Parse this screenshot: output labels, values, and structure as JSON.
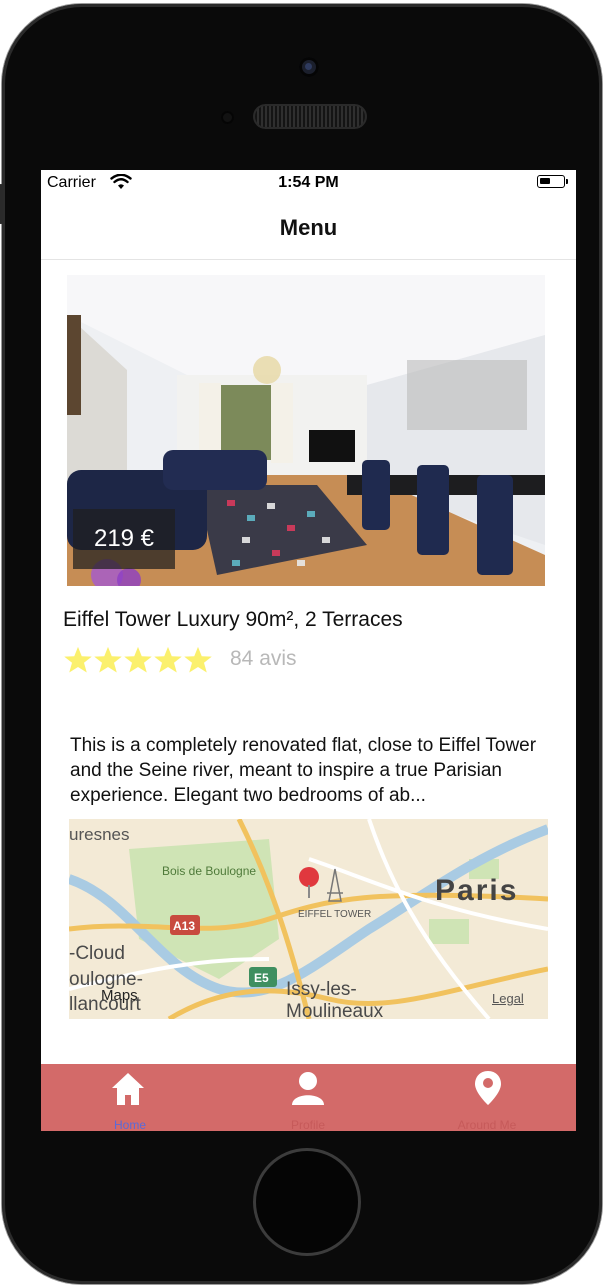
{
  "status_bar": {
    "carrier": "Carrier",
    "time": "1:54 PM"
  },
  "nav": {
    "title": "Menu"
  },
  "listing": {
    "price": "219 €",
    "title": "Eiffel Tower Luxury 90m², 2 Terraces",
    "rating": 5,
    "rating_max": 5,
    "reviews": "84 avis",
    "description": "This is a completely renovated flat, close to Eiffel Tower and the Seine river, meant to inspire a true Parisian experience. Elegant two bedrooms of ab..."
  },
  "map": {
    "labels": {
      "suresnes": "uresnes",
      "bois": "Bois de Boulogne",
      "paris": "Paris",
      "eiffel": "EIFFEL TOWER",
      "a13": "A13",
      "cloud": "-Cloud",
      "boulogne1": "oulogne-",
      "boulogne2": "llancourt",
      "e5": "E5",
      "issy1": "Issy-les-",
      "issy2": "Moulineaux",
      "maps": "Maps",
      "legal": "Legal"
    }
  },
  "tabs": [
    {
      "label": "Home",
      "icon": "home-icon",
      "active": true
    },
    {
      "label": "Profile",
      "icon": "user-icon",
      "active": false
    },
    {
      "label": "Around Me",
      "icon": "location-pin-icon",
      "active": false
    }
  ],
  "colors": {
    "tab_bar": "#d36a69",
    "tab_active": "#5a6ad8",
    "star": "#fbf06d",
    "review_text": "#b8b8b8",
    "map_pin": "#e0383e"
  }
}
